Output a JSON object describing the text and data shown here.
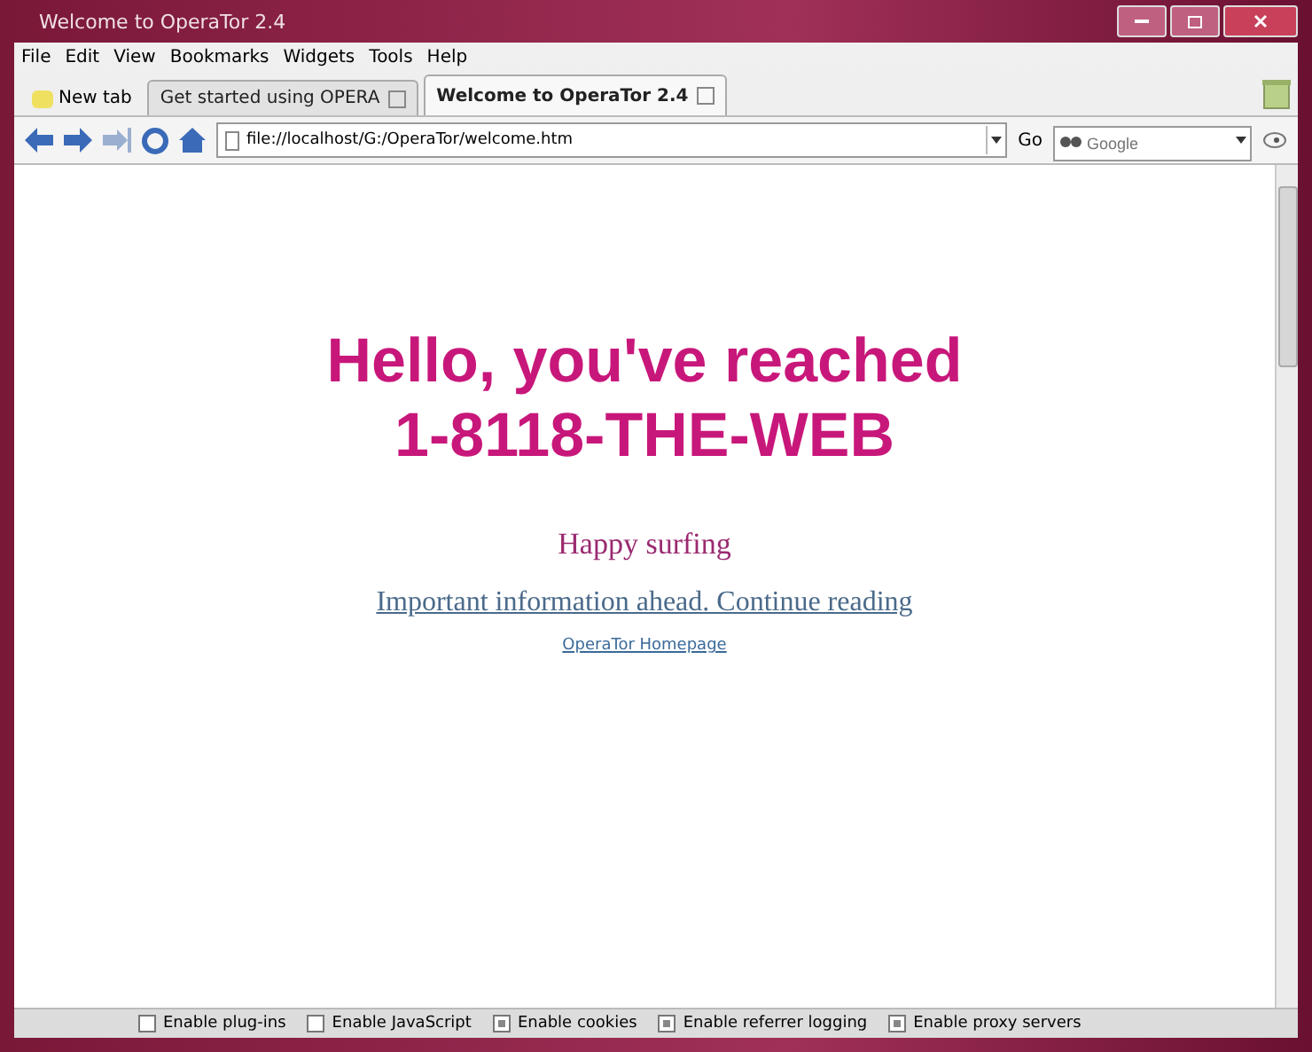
{
  "window": {
    "title": "Welcome to OperaTor 2.4"
  },
  "menu": [
    "File",
    "Edit",
    "View",
    "Bookmarks",
    "Widgets",
    "Tools",
    "Help"
  ],
  "new_tab": "New tab",
  "tabs": [
    {
      "label": "Get started using OPERA",
      "selected": false
    },
    {
      "label": "Welcome to OperaTor 2.4",
      "selected": true
    }
  ],
  "address": "file://localhost/G:/OperaTor/welcome.htm",
  "go": "Go",
  "search": {
    "placeholder": "Google"
  },
  "page": {
    "heading_lines": [
      "Hello, you've reached",
      "1-8118-THE-WEB"
    ],
    "subtitle": "Happy surfing",
    "link": "Important information ahead. Continue reading",
    "small_link": "OperaTor Homepage"
  },
  "status_options": [
    {
      "label": "Enable plug-ins",
      "checked": false
    },
    {
      "label": "Enable JavaScript",
      "checked": false
    },
    {
      "label": "Enable cookies",
      "checked": true
    },
    {
      "label": "Enable referrer logging",
      "checked": true
    },
    {
      "label": "Enable proxy servers",
      "checked": true
    }
  ]
}
